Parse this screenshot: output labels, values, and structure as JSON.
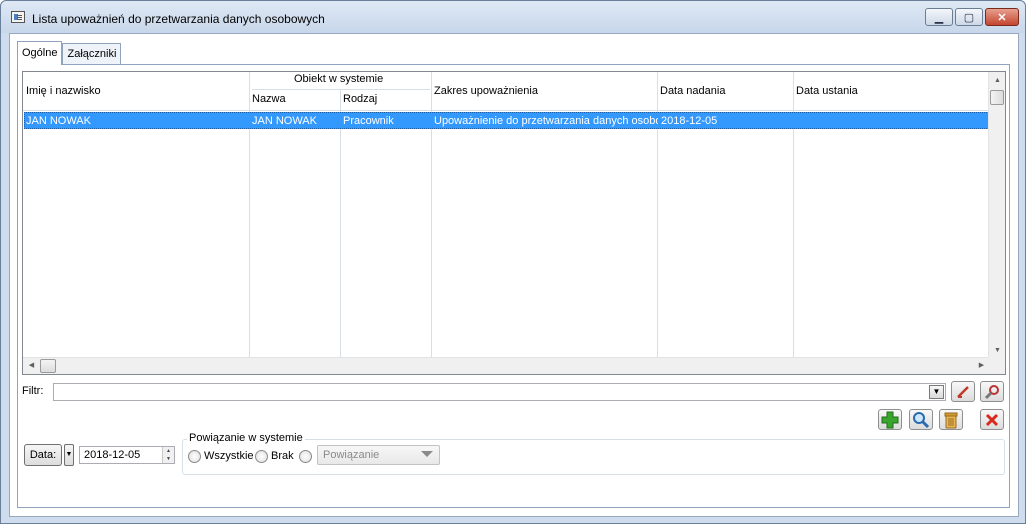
{
  "window": {
    "title": "Lista upoważnień do przetwarzania danych osobowych"
  },
  "tabs": [
    {
      "label": "Ogólne",
      "active": true
    },
    {
      "label": "Załączniki",
      "active": false
    }
  ],
  "grid": {
    "headers": {
      "imie": "Imię i nazwisko",
      "obiekt_group": "Obiekt w systemie",
      "nazwa": "Nazwa",
      "rodzaj": "Rodzaj",
      "zakres": "Zakres upoważnienia",
      "data_nadania": "Data nadania",
      "data_ustania": "Data ustania"
    },
    "rows": [
      {
        "imie": "JAN NOWAK",
        "nazwa": "JAN NOWAK",
        "rodzaj": "Pracownik",
        "zakres": "Upoważnienie do przetwarzania danych osobowych",
        "data_nadania": "2018-12-05",
        "data_ustania": "",
        "selected": true
      }
    ],
    "selection_color": "#3399ff"
  },
  "filter": {
    "label": "Filtr:",
    "value": ""
  },
  "actions": {
    "clear_filter_icon": "clear-filter-icon",
    "filter_settings_icon": "filter-wrench-icon",
    "add_icon": "plus-icon",
    "view_icon": "magnifier-icon",
    "delete_icon": "trash-icon",
    "close_icon": "red-x-icon"
  },
  "date": {
    "button_label": "Data:",
    "value": "2018-12-05"
  },
  "powiazanie": {
    "legend": "Powiązanie w systemie",
    "options": [
      "Wszystkie",
      "Brak"
    ],
    "combo_value": "Powiązanie"
  }
}
